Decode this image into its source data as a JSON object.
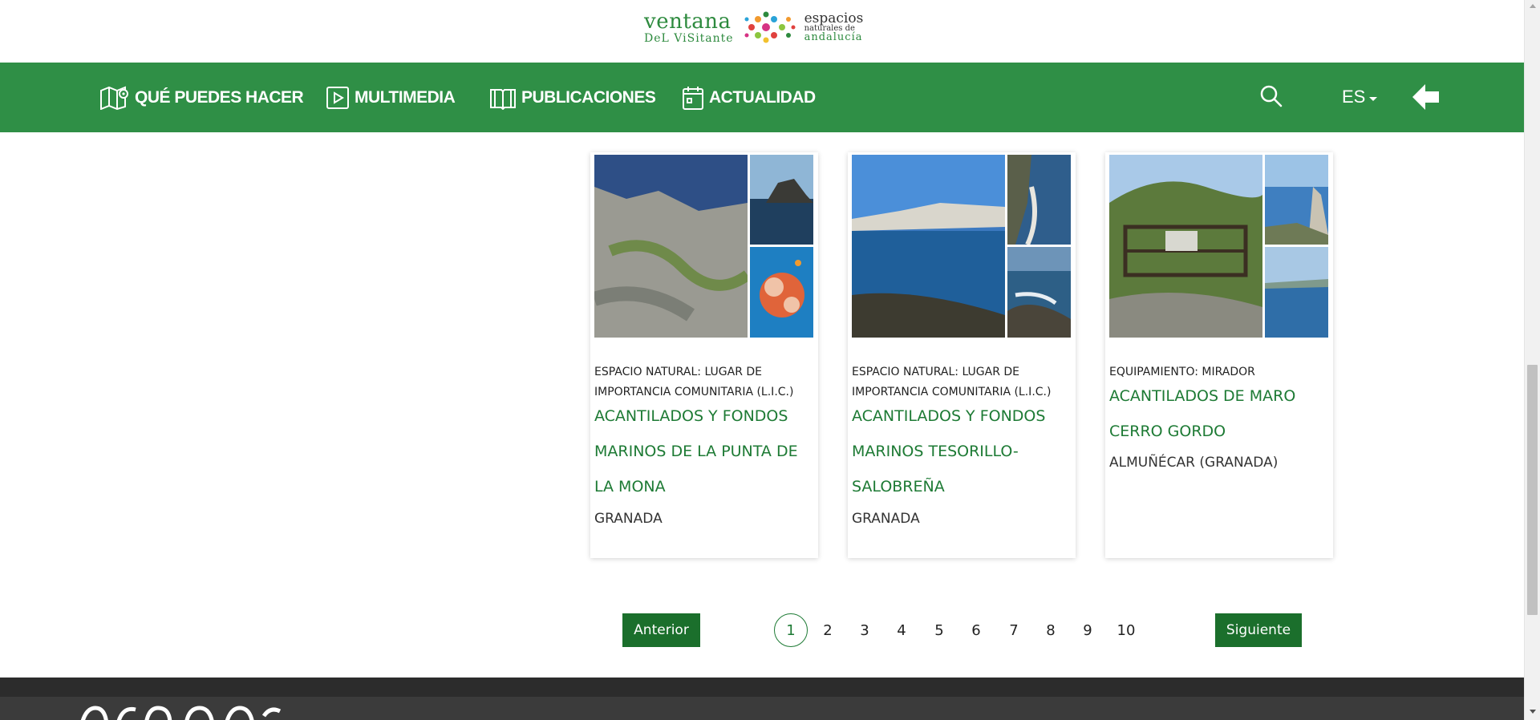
{
  "logo": {
    "line1": "ventana",
    "line2": "DeL ViSitante",
    "right1": "espacios",
    "right2": "naturales de",
    "right3": "andalucía"
  },
  "nav": {
    "items": [
      {
        "label": "QUÉ PUEDES HACER",
        "icon": "map-pin-icon"
      },
      {
        "label": "MULTIMEDIA",
        "icon": "play-icon"
      },
      {
        "label": "PUBLICACIONES",
        "icon": "book-icon"
      },
      {
        "label": "ACTUALIDAD",
        "icon": "calendar-icon"
      }
    ],
    "language": "ES",
    "search_icon": "search-icon",
    "back_icon": "arrow-left-icon"
  },
  "cards": [
    {
      "category": "ESPACIO NATURAL: LUGAR DE IMPORTANCIA COMUNITARIA (L.I.C.)",
      "title": "ACANTILADOS Y FONDOS MARINOS DE LA PUNTA DE LA MONA",
      "location": "GRANADA"
    },
    {
      "category": "ESPACIO NATURAL: LUGAR DE IMPORTANCIA COMUNITARIA (L.I.C.)",
      "title": "ACANTILADOS Y FONDOS MARINOS TESORILLO-SALOBREÑA",
      "location": "GRANADA"
    },
    {
      "category": "EQUIPAMIENTO: MIRADOR",
      "title": "ACANTILADOS DE MARO CERRO GORDO",
      "location": "ALMUÑÉCAR (GRANADA)"
    }
  ],
  "pagination": {
    "prev_label": "Anterior",
    "next_label": "Siguiente",
    "pages": [
      "1",
      "2",
      "3",
      "4",
      "5",
      "6",
      "7",
      "8",
      "9",
      "10"
    ],
    "current": "1"
  },
  "colors": {
    "nav_green": "#2f8f46",
    "title_green": "#1d7a34",
    "button_green": "#1b6f2c",
    "footer": "#3b3b3b"
  }
}
